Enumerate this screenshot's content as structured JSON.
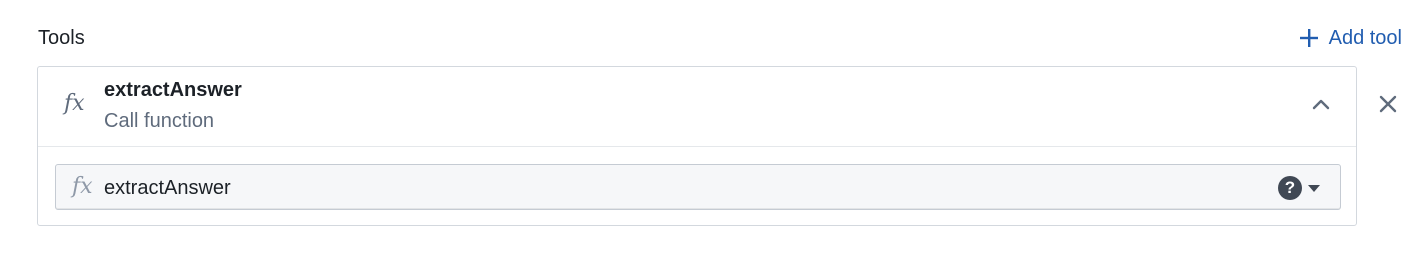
{
  "tools_section": {
    "title": "Tools",
    "add_button_label": "Add tool"
  },
  "tool_card": {
    "name": "extractAnswer",
    "type_label": "Call function",
    "icon": "function-icon",
    "icon_glyph": "fx",
    "expanded": true,
    "selector": {
      "icon_glyph": "fx",
      "value": "extractAnswer",
      "help_glyph": "?"
    }
  },
  "colors": {
    "accent": "#215db0",
    "text": "#1c2127",
    "muted": "#5f6b7c",
    "border": "#d3d8de"
  }
}
